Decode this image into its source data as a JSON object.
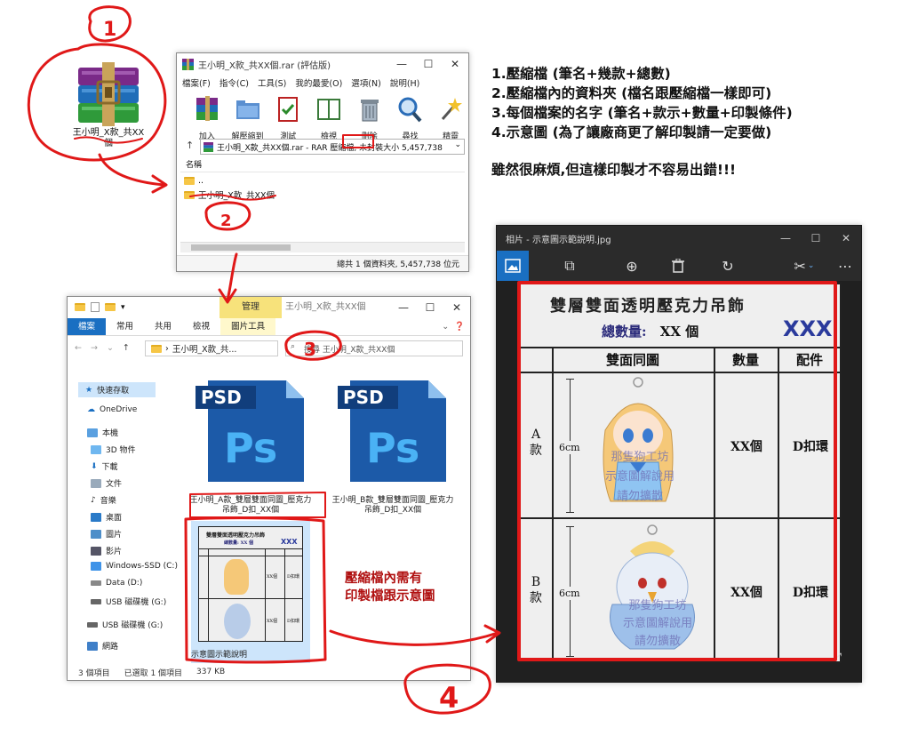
{
  "desktop": {
    "rar_icon_label": "王小明_X款_共XX個"
  },
  "winrar": {
    "title": "王小明_X款_共XX個.rar (評估版)",
    "menu": [
      "檔案(F)",
      "指令(C)",
      "工具(S)",
      "我的最愛(O)",
      "選項(N)",
      "說明(H)"
    ],
    "tools": [
      "加入",
      "解壓縮到",
      "測試",
      "檢視",
      "刪除",
      "尋找",
      "精靈"
    ],
    "path": "王小明_X款_共XX個.rar - RAR 壓縮檔, 未封裝大小 5,457,738",
    "column_name": "名稱",
    "rows": [
      "..",
      "王小明_X款_共XX個"
    ],
    "status": "總共 1 個資料夾, 5,457,738 位元"
  },
  "explorer": {
    "manage_tab": "管理",
    "title": "王小明_X款_共XX個",
    "ribbon_tabs": [
      "檔案",
      "常用",
      "共用",
      "檢視",
      "圖片工具"
    ],
    "path": "王小明_X款_共...",
    "search_placeholder": "搜尋 王小明_X款_共XX個",
    "sidebar": [
      "快速存取",
      "OneDrive",
      "本機",
      "3D 物件",
      "下載",
      "文件",
      "音樂",
      "桌面",
      "圖片",
      "影片",
      "Windows-SSD (C:)",
      "Data (D:)",
      "USB 磁碟機 (G:)",
      "USB 磁碟機 (G:)",
      "網路"
    ],
    "files": [
      {
        "label": "王小明_A款_雙層雙面同圖_壓克力吊飾_D扣_XX個",
        "badge": "PSD"
      },
      {
        "label": "王小明_B款_雙層雙面同圖_壓克力吊飾_D扣_XX個",
        "badge": "PSD"
      }
    ],
    "thumb_label": "示意圖示範說明",
    "status": [
      "3 個項目",
      "已選取 1 個項目",
      "337 KB"
    ]
  },
  "photos": {
    "title": "相片 - 示意圖示範說明.jpg",
    "sheet": {
      "title": "雙層雙面透明壓克力吊飾",
      "total_label": "總數量:",
      "total_value": "XX 個",
      "xxx": "XXX",
      "col_design": "雙面同圖",
      "col_qty": "數量",
      "col_part": "配件",
      "rows": [
        {
          "label": "A\n款",
          "size": "6cm",
          "qty": "XX個",
          "part": "D扣環"
        },
        {
          "label": "B\n款",
          "size": "6cm",
          "qty": "XX個",
          "part": "D扣環"
        }
      ],
      "watermark": [
        "那隻狗工坊",
        "示意圖解說用",
        "請勿擴散"
      ]
    }
  },
  "instructions": {
    "lines": [
      "1.壓縮檔 (筆名+幾款+總數)",
      "2.壓縮檔內的資料夾 (檔名跟壓縮檔一樣即可)",
      "3.每個檔案的名字 (筆名+款示+數量+印製條件)",
      "4.示意圖 (為了讓廠商更了解印製請一定要做)"
    ],
    "note": "雖然很麻煩,但這樣印製才不容易出錯!!!"
  },
  "inner_note": [
    "壓縮檔內需有",
    "印製檔跟示意圖"
  ],
  "annotation_numbers": [
    "1",
    "2",
    "3",
    "4"
  ],
  "colors": {
    "annotation": "#e01818",
    "explorer_file_tab": "#1a6fc2",
    "manage_tab": "#f7e27b",
    "ps_blue": "#1c5aa8"
  }
}
